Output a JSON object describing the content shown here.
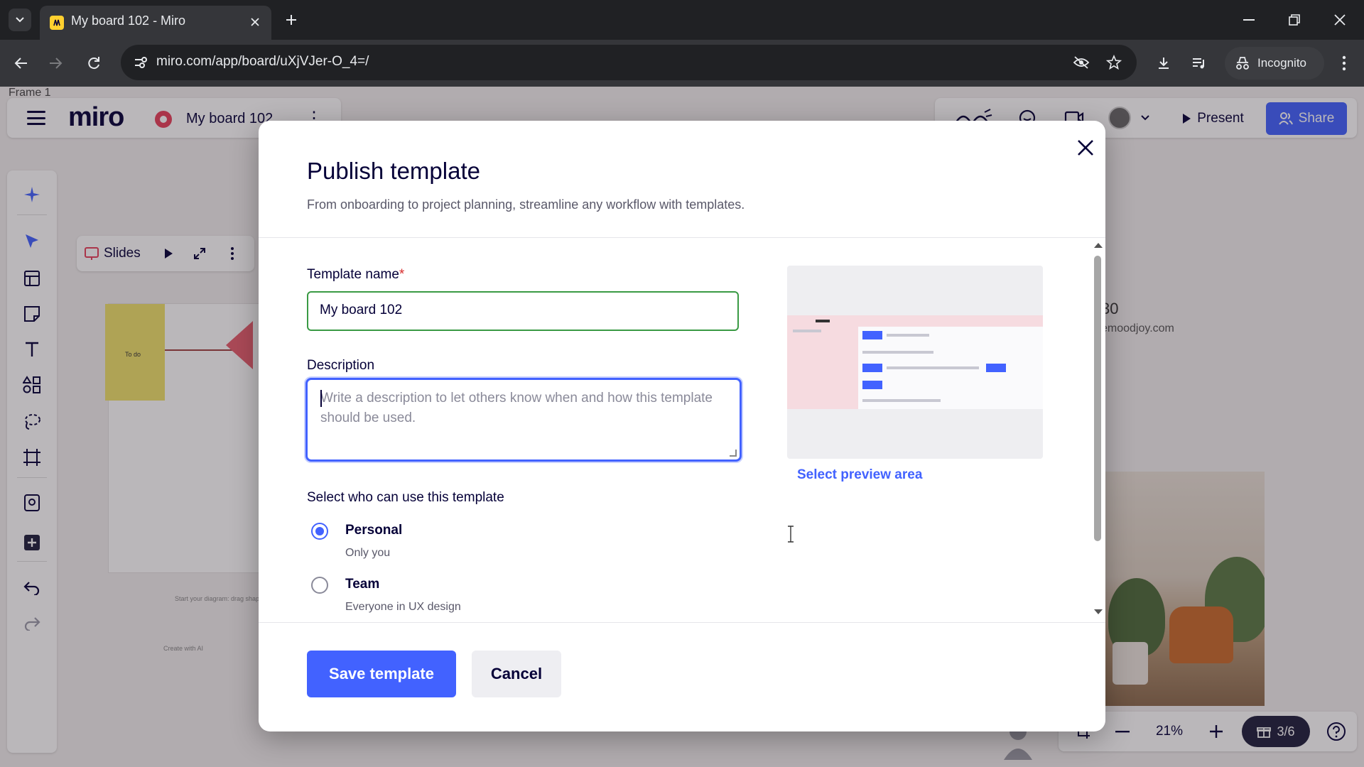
{
  "browser": {
    "tab_title": "My board 102 - Miro",
    "url": "miro.com/app/board/uXjVJer-O_4=/",
    "incognito_label": "Incognito"
  },
  "app": {
    "frame_label": "Frame 1",
    "logo": "miro",
    "board_name": "My board 102",
    "present_label": "Present",
    "share_label": "Share",
    "slides_label": "Slides",
    "sticky_text": "To do",
    "info_number": "30",
    "info_email": "emoodjoy.com",
    "canvas_hint": "Start your diagram: drag shapes",
    "canvas_create_ai": "Create with AI",
    "zoom_level": "21%",
    "pages_label": "3/6",
    "brand_color": "#4262ff"
  },
  "modal": {
    "title": "Publish template",
    "subtitle": "From onboarding to project planning, streamline any workflow with templates.",
    "name_label": "Template name",
    "name_required_mark": "*",
    "name_value": "My board 102",
    "description_label": "Description",
    "description_placeholder": "Write a description to let others know when and how this template should be used.",
    "who_label": "Select who can use this template",
    "options": [
      {
        "title": "Personal",
        "subtitle": "Only you",
        "selected": true
      },
      {
        "title": "Team",
        "subtitle": "Everyone in UX design",
        "selected": false
      }
    ],
    "select_preview_label": "Select preview area",
    "save_label": "Save template",
    "cancel_label": "Cancel"
  }
}
